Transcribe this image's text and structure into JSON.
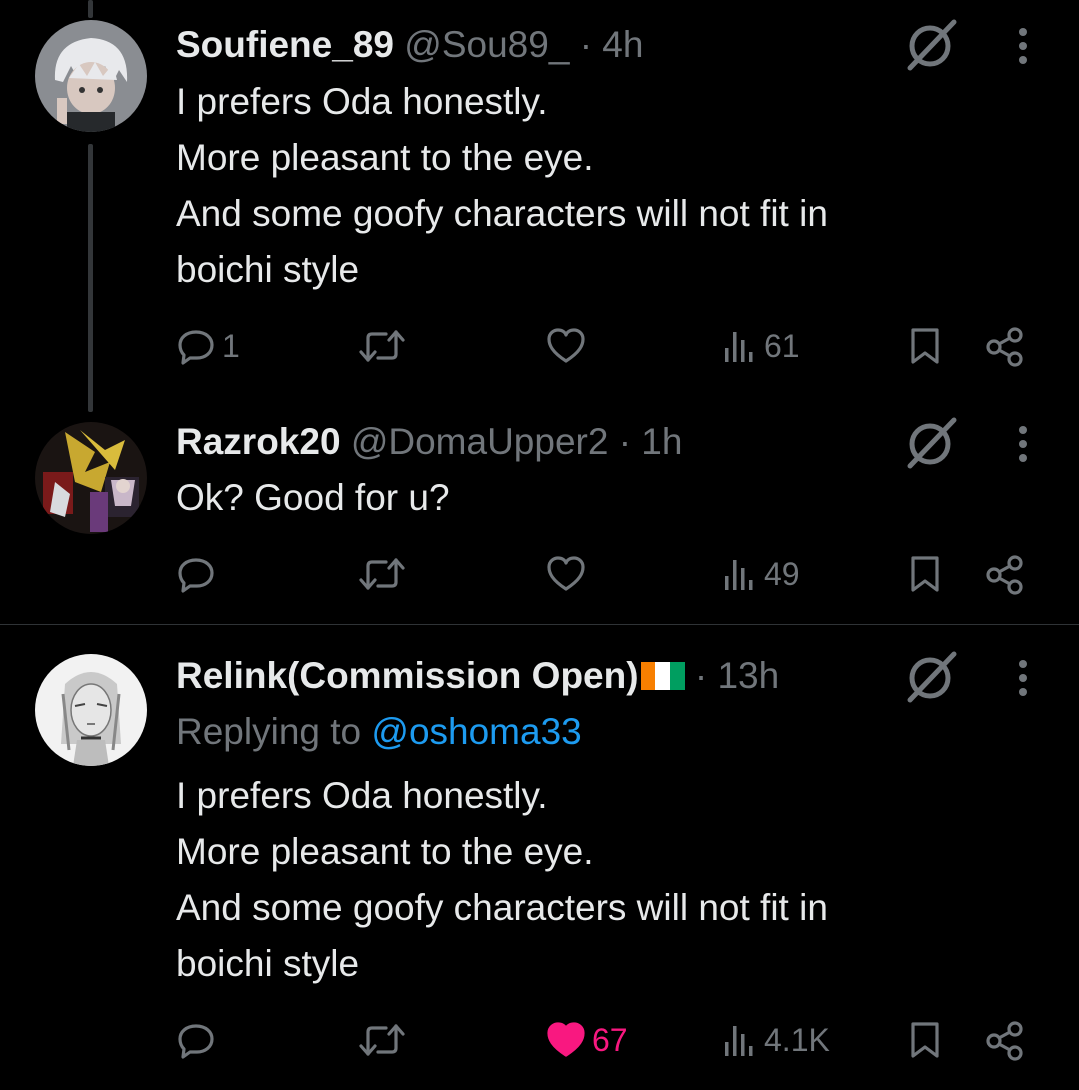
{
  "tweets": [
    {
      "display_name": "Soufiene_89",
      "handle": "@Sou89_",
      "time": "· 4h",
      "lines": [
        "I prefers Oda honestly.",
        "More pleasant to the eye.",
        "And some goofy characters will not fit in",
        "boichi style"
      ],
      "replies": "1",
      "retweets": "",
      "likes": "",
      "views": "61"
    },
    {
      "display_name": "Razrok20",
      "handle": "@DomaUpper2",
      "time": "· 1h",
      "lines": [
        "Ok? Good for u?"
      ],
      "replies": "",
      "retweets": "",
      "likes": "",
      "views": "49"
    },
    {
      "display_name": "Relink(Commission Open)",
      "handle": "",
      "time": "· 13h",
      "replying_prefix": "Replying to",
      "replying_to": "@oshoma33",
      "lines": [
        "I prefers Oda honestly.",
        "More pleasant to the eye.",
        "And some goofy characters will not fit in",
        "boichi style"
      ],
      "replies": "",
      "retweets": "",
      "likes": "67",
      "views": "4.1K"
    }
  ],
  "icons": {
    "reply": "reply-icon",
    "retweet": "retweet-icon",
    "like": "heart-icon",
    "views": "views-icon",
    "bookmark": "bookmark-icon",
    "share": "share-icon",
    "grok": "grok-icon",
    "more": "more-icon",
    "flag": "ivory-coast-flag"
  },
  "colors": {
    "background": "#000000",
    "text": "#e7e9ea",
    "muted": "#71767b",
    "mention": "#1d9bf0",
    "like": "#f91880",
    "divider": "#2f3336"
  }
}
